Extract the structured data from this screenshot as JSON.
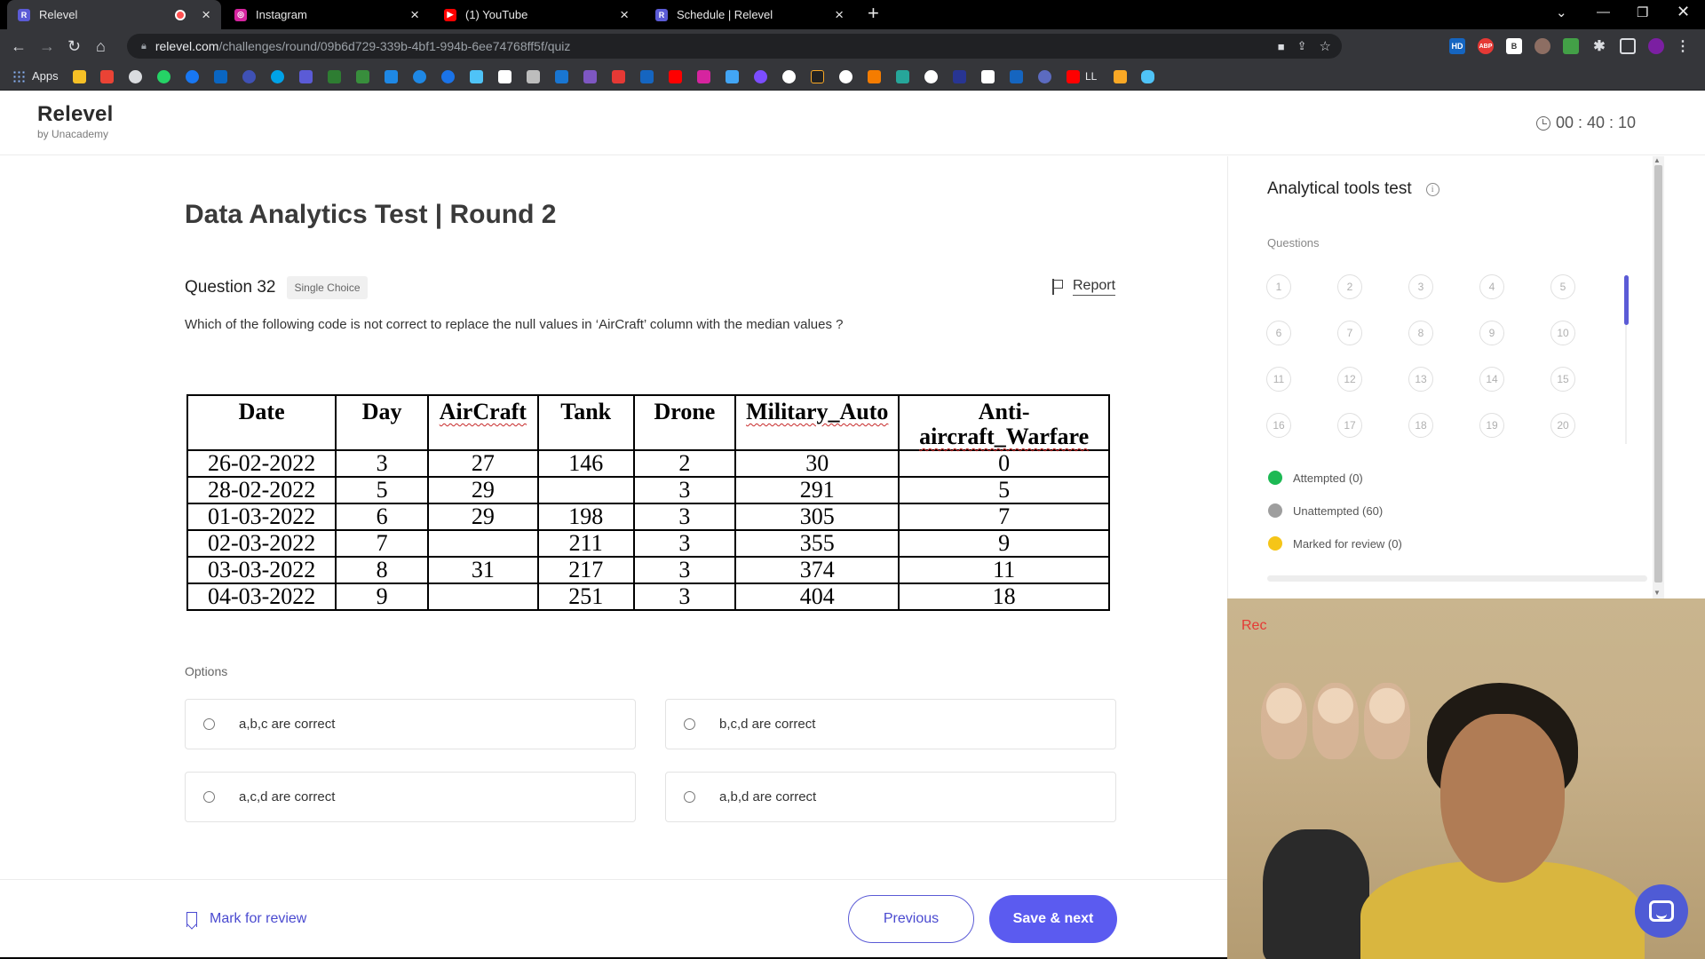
{
  "browser": {
    "tabs": [
      {
        "title": "Relevel",
        "favicon": "R",
        "favicon_color": "#5b5bd6",
        "active": true,
        "recording": true
      },
      {
        "title": "Instagram",
        "favicon": "ig",
        "favicon_color": "#d6249f",
        "active": false
      },
      {
        "title": "(1) YouTube",
        "favicon": "▶",
        "favicon_color": "#ff0000",
        "active": false
      },
      {
        "title": "Schedule | Relevel",
        "favicon": "R",
        "favicon_color": "#5b5bd6",
        "active": false
      }
    ],
    "url_host": "relevel.com",
    "url_path": "/challenges/round/09b6d729-339b-4bf1-994b-6ee74768ff5f/quiz",
    "bookmarks_apps_label": "Apps",
    "bookmark_ll_label": "LL",
    "extension_labels": [
      "HD",
      "ABP",
      "B"
    ]
  },
  "header": {
    "logo": "Relevel",
    "logo_sub": "by Unacademy",
    "timer": "00 : 40 : 10"
  },
  "main": {
    "test_title": "Data Analytics Test | Round 2",
    "question_number": "Question 32",
    "question_type": "Single Choice",
    "report_label": "Report",
    "question_text": "Which of the following code is not correct to replace the null values in ‘AirCraft’ column with the median values ?",
    "table": {
      "headers": [
        "Date",
        "Day",
        "AirCraft",
        "Tank",
        "Drone",
        "Military_Auto",
        "Anti-aircraft_Warfare"
      ],
      "header_anti_line1": "Anti-",
      "header_anti_line2": "aircraft_Warfare",
      "rows": [
        [
          "26-02-2022",
          "3",
          "27",
          "146",
          "2",
          "30",
          "0"
        ],
        [
          "28-02-2022",
          "5",
          "29",
          "",
          "3",
          "291",
          "5"
        ],
        [
          "01-03-2022",
          "6",
          "29",
          "198",
          "3",
          "305",
          "7"
        ],
        [
          "02-03-2022",
          "7",
          "",
          "211",
          "3",
          "355",
          "9"
        ],
        [
          "03-03-2022",
          "8",
          "31",
          "217",
          "3",
          "374",
          "11"
        ],
        [
          "04-03-2022",
          "9",
          "",
          "251",
          "3",
          "404",
          "18"
        ]
      ]
    },
    "options_label": "Options",
    "options": [
      "a,b,c are correct",
      "b,c,d are correct",
      "a,c,d are correct",
      "a,b,d are correct"
    ]
  },
  "footer": {
    "mark_review": "Mark for review",
    "previous": "Previous",
    "save_next": "Save & next"
  },
  "side": {
    "title": "Analytical tools test",
    "questions_label": "Questions",
    "question_numbers": [
      "1",
      "2",
      "3",
      "4",
      "5",
      "6",
      "7",
      "8",
      "9",
      "10",
      "11",
      "12",
      "13",
      "14",
      "15",
      "16",
      "17",
      "18",
      "19",
      "20"
    ],
    "legend": [
      {
        "label": "Attempted (0)",
        "color": "#1db954"
      },
      {
        "label": "Unattempted (60)",
        "color": "#9e9e9e"
      },
      {
        "label": "Marked for review (0)",
        "color": "#f5c518"
      }
    ]
  },
  "webcam": {
    "rec_label": "Rec"
  }
}
